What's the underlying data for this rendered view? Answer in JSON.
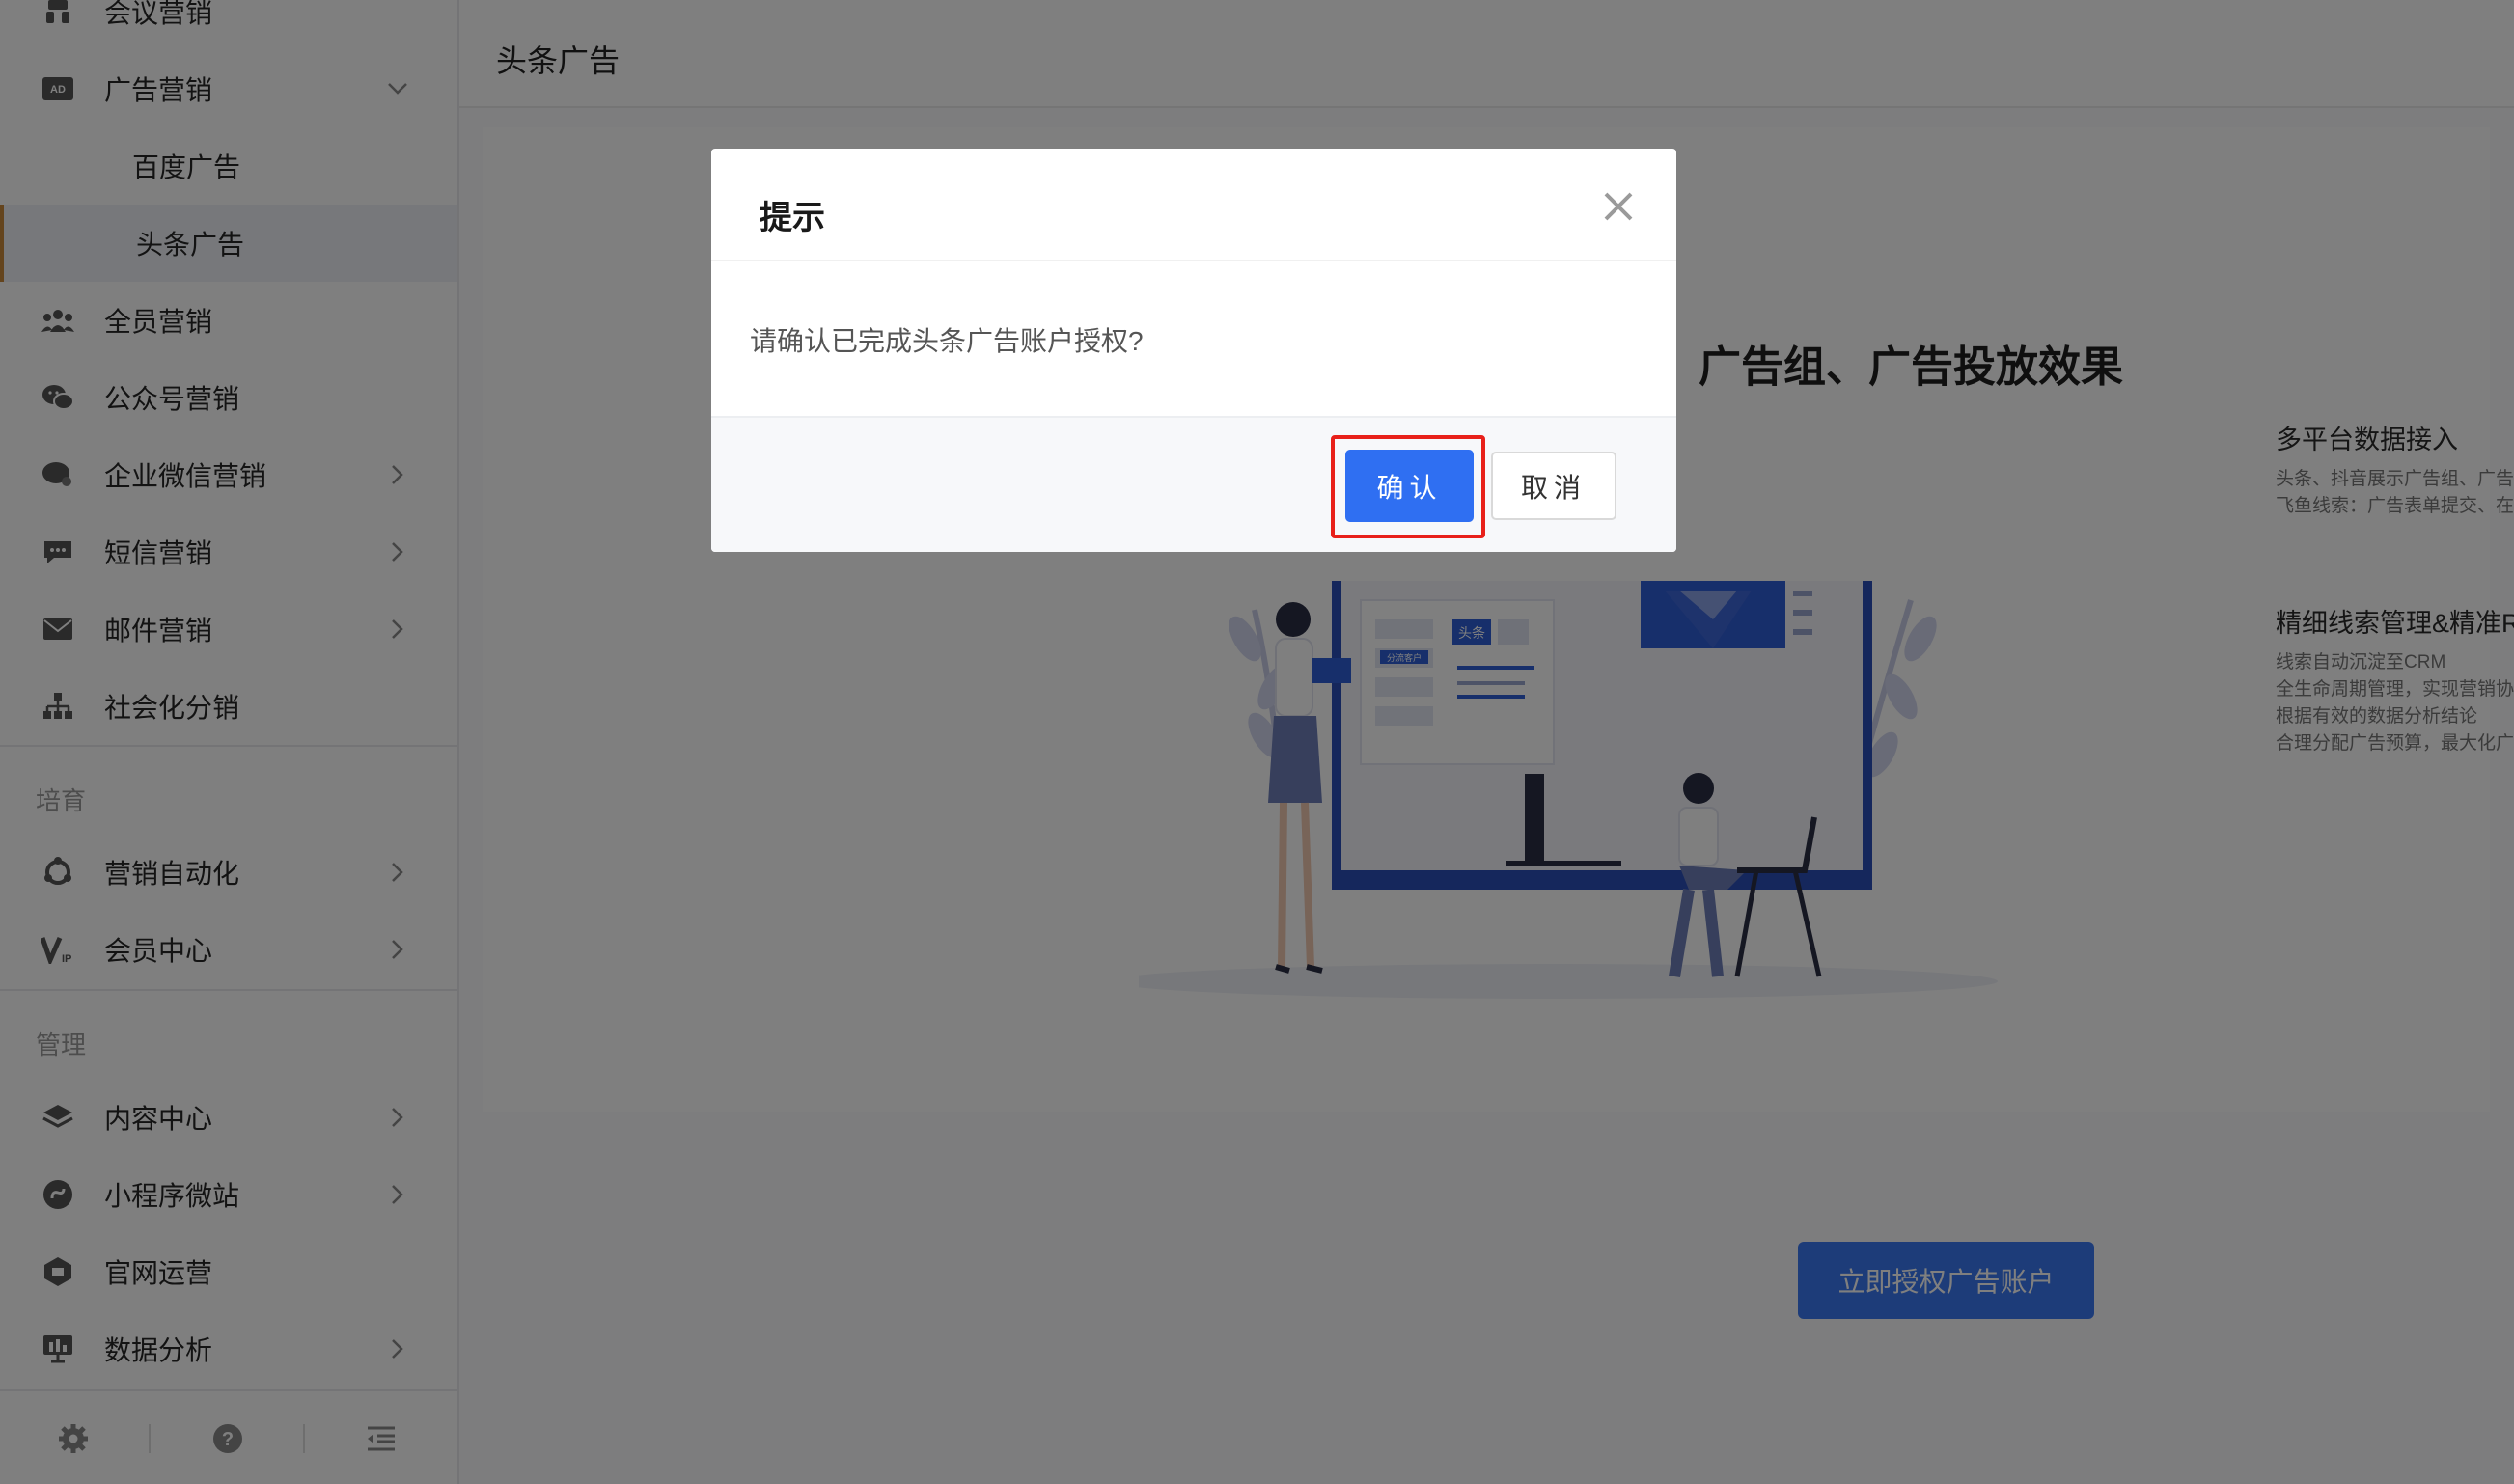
{
  "sidebar": {
    "items": [
      {
        "label": "会议营销",
        "icon": "meeting-icon"
      },
      {
        "label": "广告营销",
        "icon": "ad-icon",
        "expanded": true
      },
      {
        "label": "百度广告"
      },
      {
        "label": "头条广告",
        "active": true
      },
      {
        "label": "全员营销",
        "icon": "team-icon"
      },
      {
        "label": "公众号营销",
        "icon": "wechat-icon"
      },
      {
        "label": "企业微信营销",
        "icon": "work-wechat-icon"
      },
      {
        "label": "短信营销",
        "icon": "sms-icon"
      },
      {
        "label": "邮件营销",
        "icon": "mail-icon"
      },
      {
        "label": "社会化分销",
        "icon": "org-tree-icon"
      },
      {
        "label": "营销自动化",
        "icon": "automation-icon"
      },
      {
        "label": "会员中心",
        "icon": "vip-icon"
      },
      {
        "label": "内容中心",
        "icon": "layers-icon"
      },
      {
        "label": "小程序微站",
        "icon": "miniapp-icon"
      },
      {
        "label": "官网运营",
        "icon": "website-icon"
      },
      {
        "label": "数据分析",
        "icon": "chart-icon"
      }
    ],
    "sections": {
      "nurture": "培育",
      "manage": "管理"
    },
    "bottom_icons": [
      "gear-icon",
      "help-icon",
      "collapse-menu-icon"
    ]
  },
  "header": {
    "title": "头条广告"
  },
  "main": {
    "headline": "广告组、广告投放效果",
    "features": [
      {
        "title": "多平台数据接入",
        "lines": [
          "头条、抖音展示广告组、广告计划投放展现、点击、消费",
          "飞鱼线索：广告表单提交、在线咨询、电话等"
        ]
      },
      {
        "title": "精细线索管理&精准ROI分析",
        "lines": [
          "线索自动沉淀至CRM",
          "全生命周期管理，实现营销协同",
          "根据有效的数据分析结论",
          "合理分配广告预算，最大化广告效益"
        ]
      }
    ],
    "illustration_text": {
      "badge": "头条",
      "tag": "分流客户"
    },
    "cta_label": "立即授权广告账户"
  },
  "modal": {
    "title": "提示",
    "message": "请确认已完成头条广告账户授权?",
    "confirm_label": "确认",
    "cancel_label": "取消"
  },
  "colors": {
    "primary": "#2f6ff2",
    "highlight": "#e8201a",
    "active_accent": "#c9883a",
    "overlay": "rgba(0,0,0,0.5)"
  }
}
